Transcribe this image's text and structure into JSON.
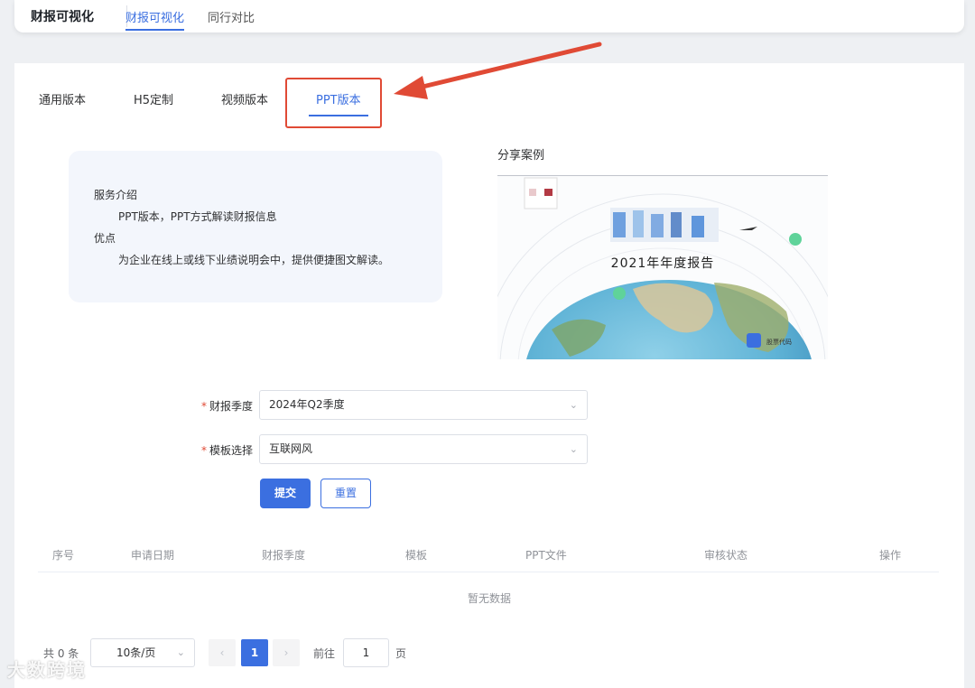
{
  "app": {
    "title": "财报可视化"
  },
  "topnav": [
    {
      "label": "财报可视化",
      "active": true
    },
    {
      "label": "同行对比",
      "active": false
    }
  ],
  "tabs": [
    {
      "label": "通用版本"
    },
    {
      "label": "H5定制"
    },
    {
      "label": "视频版本"
    },
    {
      "label": "PPT版本",
      "active": true
    }
  ],
  "intro": {
    "service_heading": "服务介绍",
    "service_text": "PPT版本，PPT方式解读财报信息",
    "advantage_heading": "优点",
    "advantage_text": "为企业在线上或线下业绩说明会中，提供便捷图文解读。"
  },
  "case": {
    "title": "分享案例",
    "image_caption": "2021年年度报告",
    "image_small_text": "股票代码"
  },
  "form": {
    "quarter_label": "财报季度",
    "quarter_value": "2024年Q2季度",
    "template_label": "模板选择",
    "template_value": "互联网风",
    "submit_label": "提交",
    "reset_label": "重置"
  },
  "table": {
    "columns": [
      "序号",
      "申请日期",
      "财报季度",
      "模板",
      "PPT文件",
      "审核状态",
      "操作"
    ],
    "empty_text": "暂无数据"
  },
  "pagination": {
    "total_text": "共 0 条",
    "page_size": "10条/页",
    "current_page": "1",
    "goto_label": "前往",
    "goto_value": "1",
    "page_suffix": "页"
  },
  "watermark": "大数跨境",
  "colors": {
    "accent": "#3b6fe0",
    "annotation": "#e04a35"
  }
}
